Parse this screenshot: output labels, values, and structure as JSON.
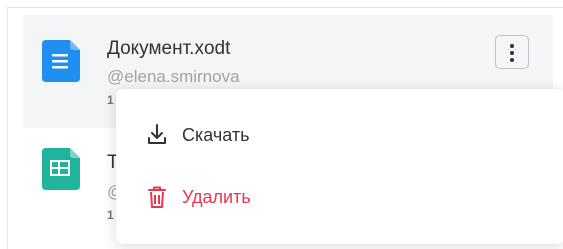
{
  "files": [
    {
      "title": "Документ.xodt",
      "owner": "@elena.smirnova",
      "meta": "1",
      "icon": "text-document-icon",
      "icon_color": "#1f8ff0",
      "selected": true
    },
    {
      "title": "Т",
      "owner": "@",
      "meta": "1",
      "icon": "table-document-icon",
      "icon_color": "#1fb49b",
      "selected": false
    }
  ],
  "more_button": {
    "icon": "more-vertical-icon"
  },
  "context_menu": {
    "items": [
      {
        "label": "Скачать",
        "icon": "download-icon",
        "color": "#333333"
      },
      {
        "label": "Удалить",
        "icon": "trash-icon",
        "color": "#e8374e"
      }
    ]
  }
}
